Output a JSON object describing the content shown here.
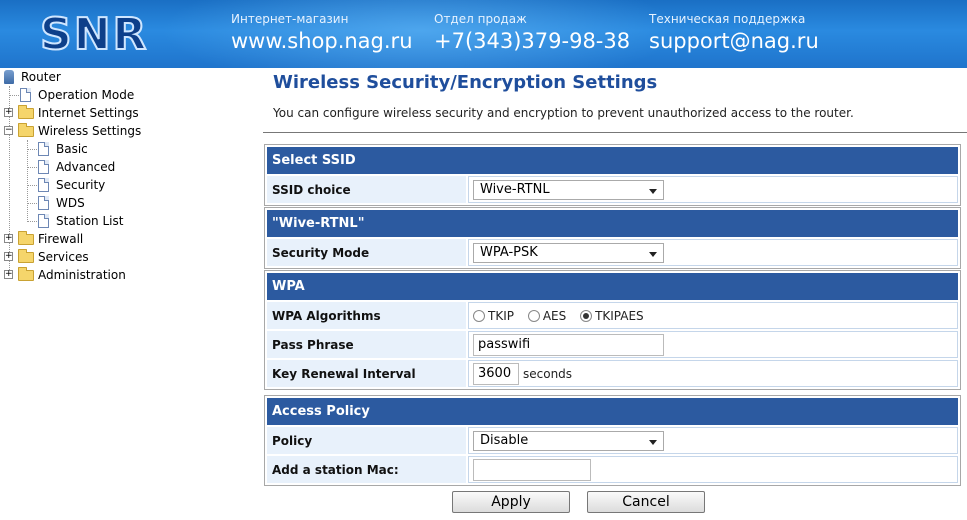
{
  "header": {
    "logo_text": "SNR",
    "shop": {
      "caption": "Интернет-магазин",
      "value": "www.shop.nag.ru"
    },
    "sales": {
      "caption": "Отдел продаж",
      "value": "+7(343)379-98-38"
    },
    "support": {
      "caption": "Техническая поддержка",
      "value": "support@nag.ru"
    }
  },
  "sidebar": {
    "root": "Router",
    "items": {
      "operation_mode": "Operation Mode",
      "internet_settings": "Internet Settings",
      "wireless_settings": "Wireless Settings",
      "basic": "Basic",
      "advanced": "Advanced",
      "security": "Security",
      "wds": "WDS",
      "station_list": "Station List",
      "firewall": "Firewall",
      "services": "Services",
      "administration": "Administration"
    }
  },
  "page": {
    "title": "Wireless Security/Encryption Settings",
    "intro": "You can configure wireless security and encryption to prevent unauthorized access to the router."
  },
  "select_ssid": {
    "header": "Select SSID",
    "ssid_choice_label": "SSID choice",
    "ssid_choice_value": "Wive-RTNL"
  },
  "ssid_section": {
    "header": "\"Wive-RTNL\"",
    "security_mode_label": "Security Mode",
    "security_mode_value": "WPA-PSK"
  },
  "wpa": {
    "header": "WPA",
    "algorithms_label": "WPA Algorithms",
    "options": [
      "TKIP",
      "AES",
      "TKIPAES"
    ],
    "selected": "TKIPAES",
    "pass_phrase_label": "Pass Phrase",
    "pass_phrase_value": "passwifi",
    "renewal_label": "Key Renewal Interval",
    "renewal_value": "3600",
    "renewal_unit": "seconds"
  },
  "access_policy": {
    "header": "Access Policy",
    "policy_label": "Policy",
    "policy_value": "Disable",
    "add_mac_label": "Add a station Mac:",
    "add_mac_value": ""
  },
  "buttons": {
    "apply": "Apply",
    "cancel": "Cancel"
  },
  "colors": {
    "section_header": "#2c5aa0",
    "title": "#1f4e9c",
    "label_bg": "#e8f1fb",
    "banner": "#1f74cc"
  }
}
